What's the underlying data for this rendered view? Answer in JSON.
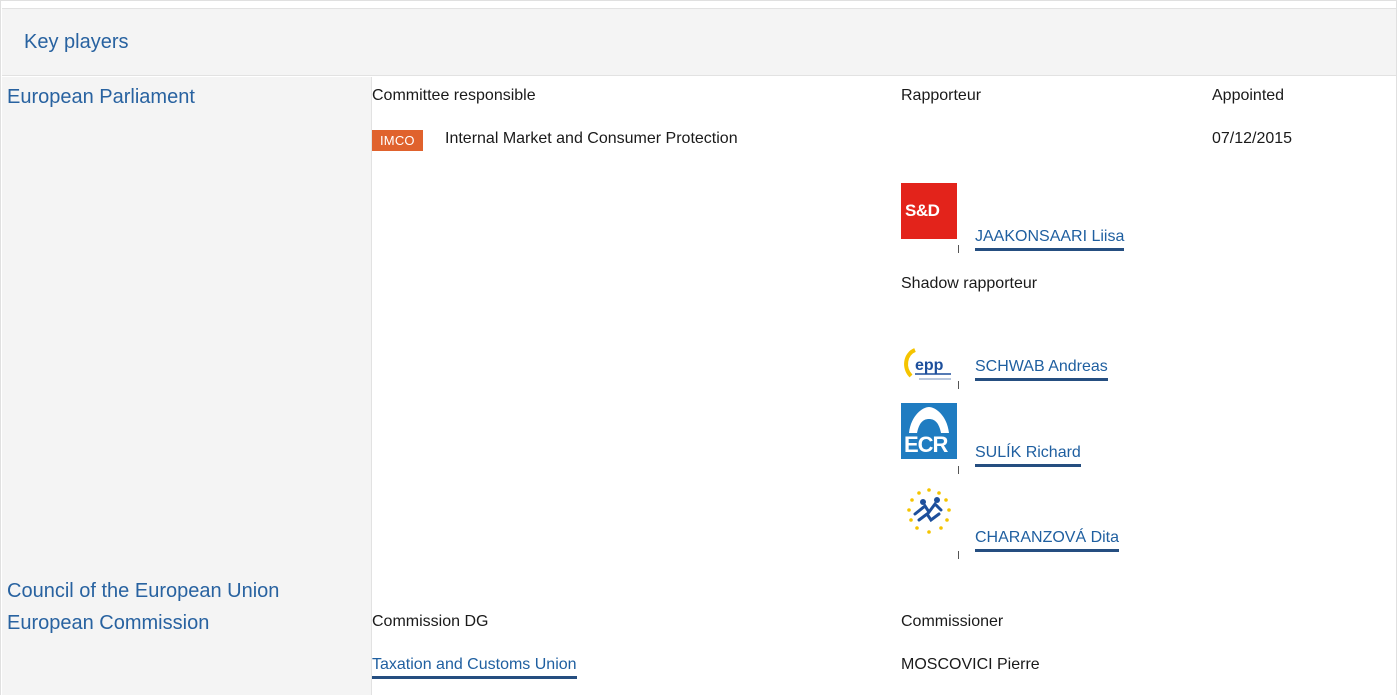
{
  "panel": {
    "title": "Key players"
  },
  "institutions": {
    "ep": "European Parliament",
    "council": "Council of the European Union",
    "commission": "European Commission"
  },
  "ep": {
    "committee_header": "Committee responsible",
    "rapporteur_header": "Rapporteur",
    "appointed_header": "Appointed",
    "committee_badge": "IMCO",
    "committee_name": "Internal Market and Consumer Protection",
    "appointed_date": "07/12/2015",
    "rapporteur": {
      "group_logo": "S&D",
      "name": "JAAKONSAARI Liisa"
    },
    "shadow_header": "Shadow rapporteur",
    "shadows": [
      {
        "group_logo": "epp",
        "name": "SCHWAB Andreas"
      },
      {
        "group_logo": "ECR",
        "name": "SULÍK Richard"
      },
      {
        "group_logo": "alde-logo",
        "name": "CHARANZOVÁ Dita"
      }
    ]
  },
  "commission": {
    "dg_header": "Commission DG",
    "commissioner_header": "Commissioner",
    "dg_name": "Taxation and Customs Union",
    "commissioner_name": "MOSCOVICI Pierre"
  },
  "colors": {
    "link": "#1f5fa0",
    "institution": "#2862a0",
    "imco_badge": "#e0622d",
    "sd_red": "#e3231b",
    "ecr_blue": "#1f7cc1"
  }
}
